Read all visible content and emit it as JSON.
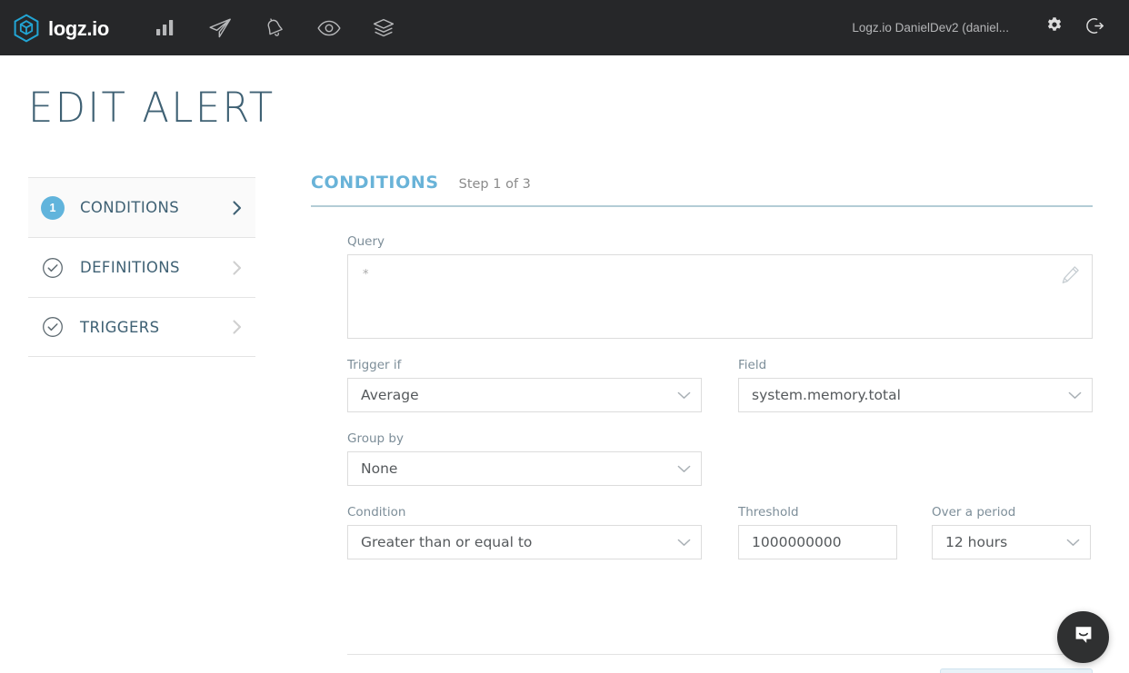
{
  "header": {
    "brand_text": "logz.io",
    "nav_items": [
      {
        "icon": "bar-chart-icon",
        "name": "nav-dashboards"
      },
      {
        "icon": "paper-plane-icon",
        "name": "nav-send-logs"
      },
      {
        "icon": "bell-icon",
        "name": "nav-alerts"
      },
      {
        "icon": "eye-icon",
        "name": "nav-insights"
      },
      {
        "icon": "layers-icon",
        "name": "nav-library"
      }
    ],
    "account": "Logz.io DanielDev2 (daniel...",
    "settings_icon": "gear-icon",
    "logout_icon": "logout-icon"
  },
  "page": {
    "title": "EDIT ALERT"
  },
  "steps": [
    {
      "badge": "1",
      "label": "CONDITIONS",
      "state": "active",
      "marker": "number"
    },
    {
      "badge": "",
      "label": "DEFINITIONS",
      "state": "complete",
      "marker": "check"
    },
    {
      "badge": "",
      "label": "TRIGGERS",
      "state": "complete",
      "marker": "check"
    }
  ],
  "content": {
    "title": "CONDITIONS",
    "step_indicator": "Step 1 of 3"
  },
  "form": {
    "query": {
      "label": "Query",
      "value": "*",
      "placeholder": "*",
      "edit_icon": "pencil-icon"
    },
    "trigger_if": {
      "label": "Trigger if",
      "value": "Average"
    },
    "field": {
      "label": "Field",
      "value": "system.memory.total"
    },
    "group_by": {
      "label": "Group by",
      "value": "None"
    },
    "condition": {
      "label": "Condition",
      "value": "Greater than or equal to"
    },
    "threshold": {
      "label": "Threshold",
      "value": "1000000000"
    },
    "over_a_period": {
      "label": "Over a period",
      "value": "12 hours"
    }
  },
  "chat": {
    "icon": "chat-bubble-icon"
  },
  "colors": {
    "accent_blue": "#61b4dc",
    "header_bg": "#262729",
    "title_slate": "#3f6174",
    "logo_cyan": "#22a5d4"
  }
}
